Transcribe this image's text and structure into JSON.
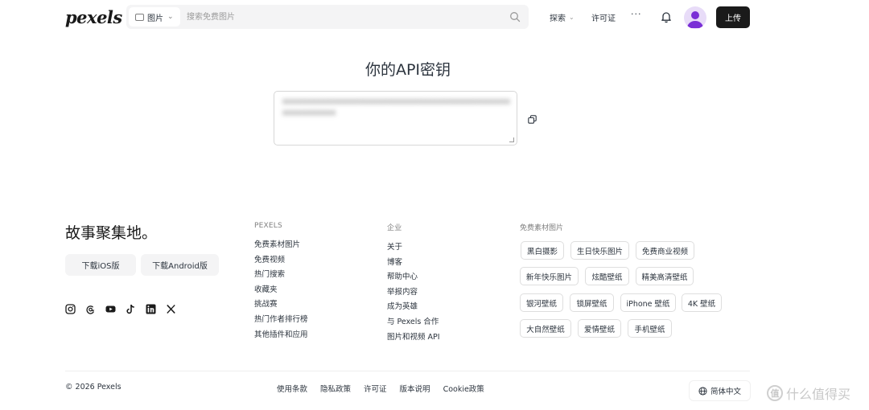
{
  "header": {
    "logo": "pexels",
    "search_type": "图片",
    "search_placeholder": "搜索免费图片",
    "nav_explore": "探索",
    "nav_license": "许可证",
    "nav_more": "···",
    "upload": "上传"
  },
  "main": {
    "title": "你的API密钥",
    "api_key": "xxxxxxxxxxxxxxxxxxxxxxxxxxxxxxxxxxxxxxxxxxxxxxxxxxxxxxxxxx"
  },
  "footer": {
    "tagline": "故事聚集地。",
    "download_ios": "下载iOS版",
    "download_android": "下载Android版",
    "columns": [
      {
        "title": "PEXELS",
        "links": [
          "免费素材图片",
          "免费视频",
          "热门搜索",
          "收藏夹",
          "挑战赛",
          "热门作者排行榜",
          "其他插件和应用"
        ]
      },
      {
        "title": "企业",
        "links": [
          "关于",
          "博客",
          "帮助中心",
          "举报内容",
          "成为英雄",
          "与 Pexels 合作",
          "图片和视频 API"
        ]
      }
    ],
    "tags_title": "免费素材图片",
    "tags": [
      "黑白摄影",
      "生日快乐图片",
      "免费商业视频",
      "新年快乐图片",
      "炫酷壁纸",
      "精美高清壁纸",
      "银河壁纸",
      "锁屏壁纸",
      "iPhone 壁纸",
      "4K 壁纸",
      "大自然壁纸",
      "爱情壁纸",
      "手机壁纸"
    ],
    "copyright": "© 2026 Pexels",
    "bottom_links": [
      "使用条款",
      "隐私政策",
      "许可证",
      "版本说明",
      "Cookie政策"
    ],
    "language": "简体中文",
    "watermark": "什么值得买"
  },
  "colors": {
    "text": "#2c343e",
    "upload_bg": "#1a1a1a",
    "avatar_bg": "#e8dcf8",
    "avatar_fg": "#7a2fd6"
  }
}
